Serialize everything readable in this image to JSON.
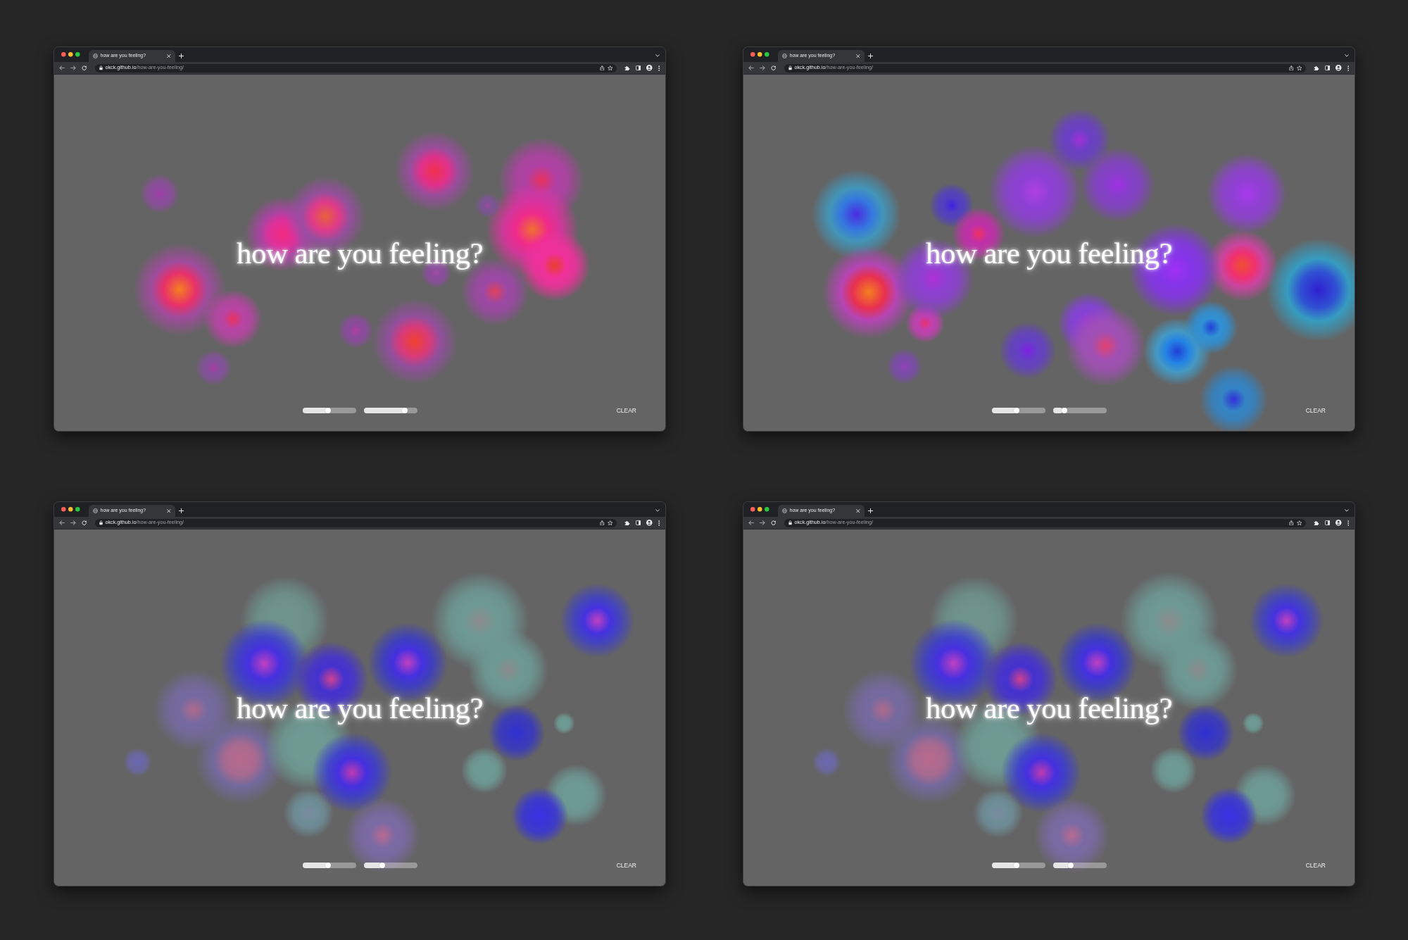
{
  "windows": [
    {
      "tabs": [
        {
          "title": "how are you feeling?",
          "selected": true
        }
      ],
      "address": {
        "host": "okck.github.io",
        "path": "/how-are-you-feeling/"
      },
      "heading": "how are you feeling?",
      "sliders": [
        {
          "level": 0.48
        },
        {
          "level": 0.8
        }
      ],
      "clear_button": "CLEAR"
    },
    {
      "tabs": [
        {
          "title": "how are you feeling?",
          "selected": true
        }
      ],
      "address": {
        "host": "okck.github.io",
        "path": "/how-are-you-feeling/"
      },
      "heading": "how are you feeling?",
      "sliders": [
        {
          "level": 0.47
        },
        {
          "level": 0.18
        }
      ],
      "clear_button": "CLEAR"
    },
    {
      "tabs": [
        {
          "title": "how are you feeling?",
          "selected": true
        }
      ],
      "address": {
        "host": "okck.github.io",
        "path": "/how-are-you-feeling/"
      },
      "heading": "how are you feeling?",
      "sliders": [
        {
          "level": 0.48
        },
        {
          "level": 0.33
        }
      ],
      "clear_button": "CLEAR"
    },
    {
      "tabs": [
        {
          "title": "how are you feeling?",
          "selected": true
        }
      ],
      "address": {
        "host": "okck.github.io",
        "path": "/how-are-you-feeling/"
      },
      "heading": "how are you feeling?",
      "sliders": [
        {
          "level": 0.47
        },
        {
          "level": 0.32
        }
      ],
      "clear_button": "CLEAR"
    }
  ]
}
